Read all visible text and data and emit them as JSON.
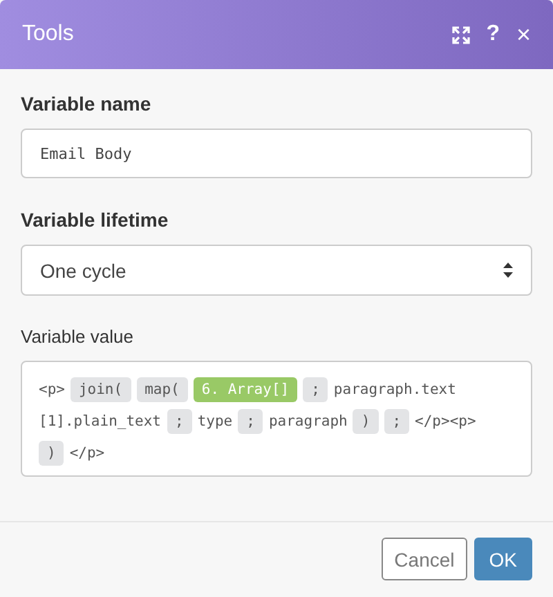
{
  "window": {
    "title": "Tools"
  },
  "header_buttons": [
    {
      "kind": "expand"
    },
    {
      "kind": "help",
      "label": "?"
    },
    {
      "kind": "close",
      "label": "×"
    }
  ],
  "variable_name": {
    "label": "Variable name",
    "value": "Email Body"
  },
  "variable_lifetime": {
    "label": "Variable lifetime",
    "value": "One cycle"
  },
  "variable_value": {
    "label": "Variable value",
    "lines": [
      [
        {
          "kind": "text",
          "text": "<p>"
        },
        {
          "kind": "function",
          "text": "join("
        },
        {
          "kind": "function",
          "text": "map("
        },
        {
          "kind": "item",
          "text": "6. Array[]"
        },
        {
          "kind": "function",
          "text": ";"
        },
        {
          "kind": "text",
          "text": "paragraph.text"
        }
      ],
      [
        {
          "kind": "text",
          "text": "[1].plain_text"
        },
        {
          "kind": "function",
          "text": ";"
        },
        {
          "kind": "text",
          "text": "type"
        },
        {
          "kind": "function",
          "text": ";"
        },
        {
          "kind": "text",
          "text": "paragraph"
        },
        {
          "kind": "function",
          "text": ")"
        },
        {
          "kind": "function",
          "text": ";"
        },
        {
          "kind": "text",
          "text": "</p><p>"
        }
      ],
      [
        {
          "kind": "function",
          "text": ")"
        },
        {
          "kind": "text",
          "text": "</p>"
        }
      ]
    ]
  },
  "buttons": [
    {
      "kind": "cancel",
      "label": "Cancel"
    },
    {
      "kind": "ok",
      "label": "OK"
    }
  ]
}
